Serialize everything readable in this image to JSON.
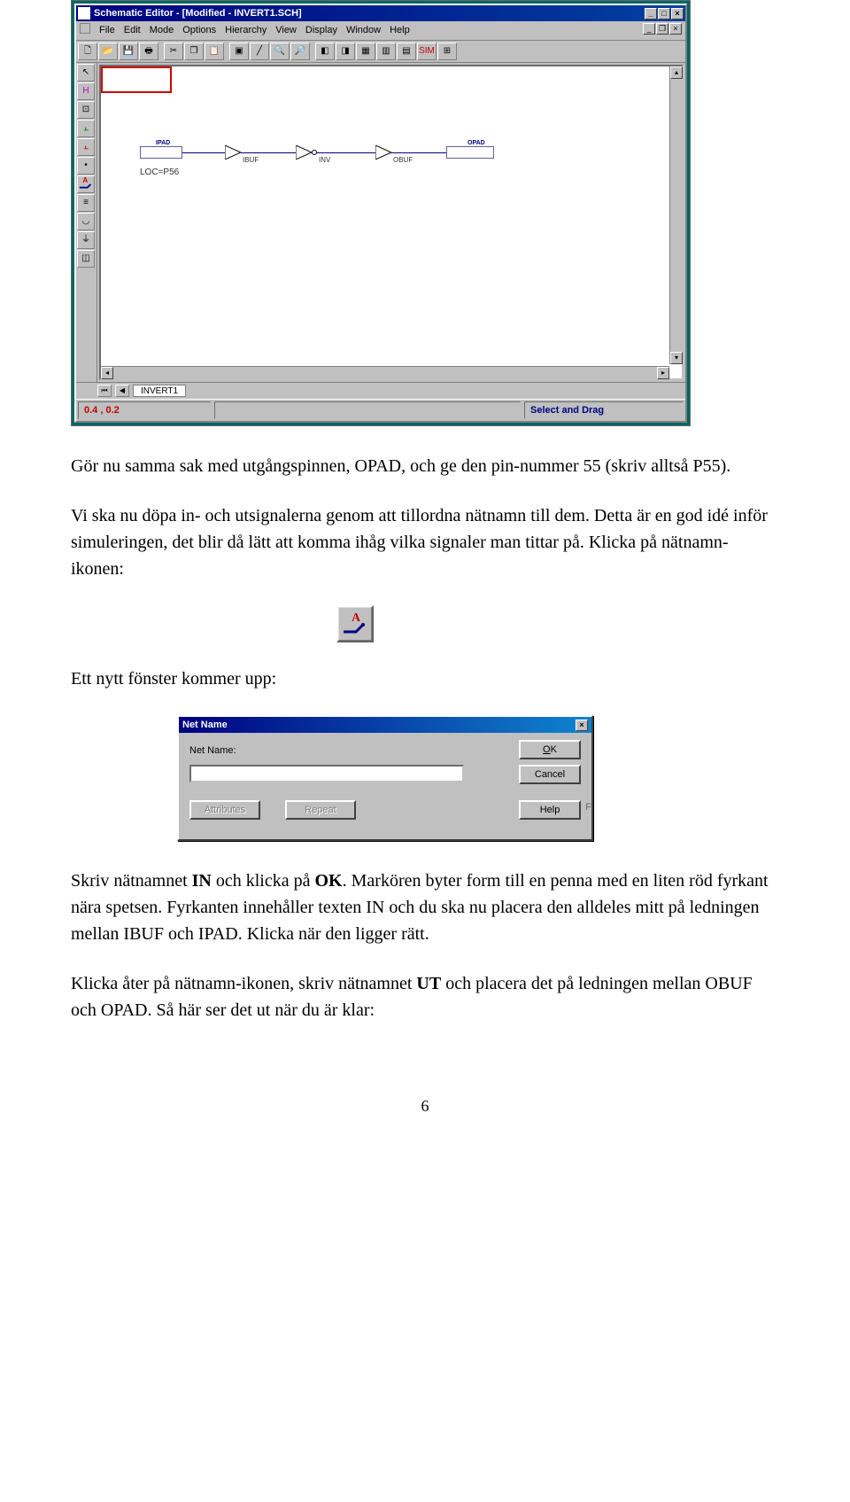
{
  "app_window": {
    "title": "Schematic Editor - [Modified - INVERT1.SCH]",
    "menus": [
      "File",
      "Edit",
      "Mode",
      "Options",
      "Hierarchy",
      "View",
      "Display",
      "Window",
      "Help"
    ],
    "tab_label": "INVERT1",
    "status_coords": "0.4 ,  0.2",
    "status_mode": "Select and Drag",
    "schematic": {
      "ipad_label": "IPAD",
      "loc_label": "LOC=P56",
      "ibuf_label": "IBUF",
      "inv_label": "INV",
      "obuf_label": "OBUF",
      "opad_label": "OPAD"
    }
  },
  "paragraphs": {
    "p1": "Gör nu samma sak med utgångspinnen, OPAD, och ge den pin-nummer 55 (skriv alltså P55).",
    "p2": "Vi ska nu döpa in- och utsignalerna genom att tillordna nätnamn till dem. Detta är en god idé inför simuleringen, det blir då lätt att komma ihåg vilka signaler man tittar på. Klicka på nätnamn-ikonen:",
    "p3": "Ett nytt fönster kommer upp:",
    "p4a": "Skriv nätnamnet ",
    "p4b": " och klicka på ",
    "p4c": ". Markören byter form till en penna med en liten röd fyrkant nära spetsen. Fyrkanten innehåller texten IN och du ska nu placera den alldeles mitt på ledningen mellan IBUF och IPAD. Klicka när den ligger rätt.",
    "p4_bold1": "IN",
    "p4_bold2": "OK",
    "p5a": "Klicka åter på nätnamn-ikonen, skriv nätnamnet ",
    "p5b": " och placera det på ledningen mellan OBUF och OPAD. Så här ser det ut när du är klar:",
    "p5_bold": "UT"
  },
  "dialog": {
    "title": "Net Name",
    "label": "Net Name:",
    "btn_ok": "OK",
    "btn_cancel": "Cancel",
    "btn_attr": "Attributes",
    "btn_repeat": "Repeat",
    "btn_help": "Help",
    "f_char": "F"
  },
  "page_number": "6"
}
